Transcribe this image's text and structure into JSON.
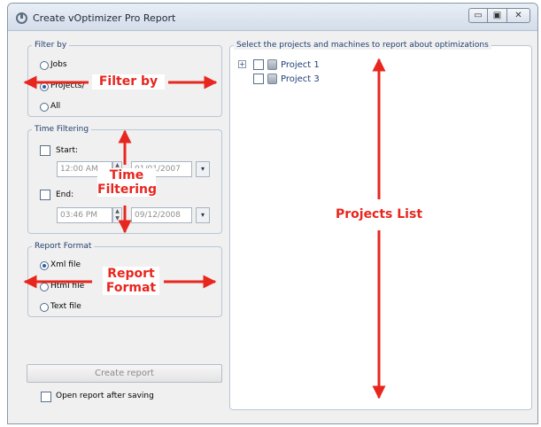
{
  "window": {
    "title": "Create vOptimizer Pro Report",
    "controls": {
      "minimize": "▭",
      "maximize": "▣",
      "close": "✕"
    }
  },
  "filter": {
    "legend": "Filter by",
    "options": [
      "Jobs",
      "Projects/",
      "All"
    ],
    "selected": "Projects/"
  },
  "time_filtering": {
    "legend": "Time Filtering",
    "start": {
      "label": "Start:",
      "time": "12:00 AM",
      "date": "01/01/2007",
      "checked": false
    },
    "end": {
      "label": "End:",
      "time": "03:46 PM",
      "date": "09/12/2008",
      "checked": false
    }
  },
  "report_format": {
    "legend": "Report Format",
    "options": [
      "Xml file",
      "Html file",
      "Text file"
    ],
    "selected": "Xml file"
  },
  "actions": {
    "create_label": "Create report",
    "open_after_label": "Open report after saving",
    "open_after_checked": false
  },
  "projects": {
    "legend": "Select the projects and machines to report about optimizations",
    "items": [
      {
        "label": "Project 1",
        "expandable": true,
        "expander": "+"
      },
      {
        "label": "Project 3",
        "expandable": false
      }
    ]
  },
  "annotations": {
    "filter_by": "Filter by",
    "time_filtering": "Time\nFiltering",
    "report_format": "Report\nFormat",
    "projects_list": "Projects List",
    "color": "#e8261e"
  }
}
